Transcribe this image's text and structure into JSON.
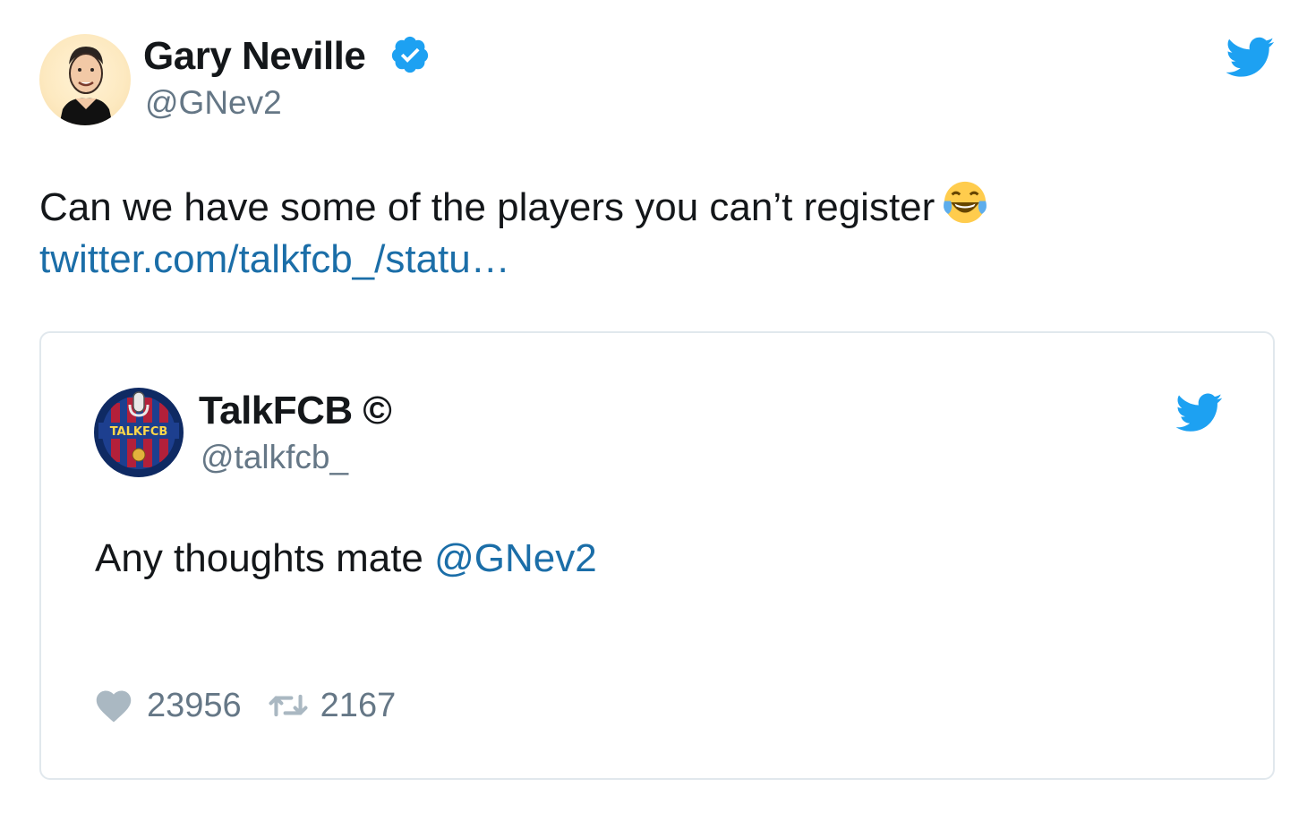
{
  "tweet": {
    "author_name": "Gary Neville",
    "author_handle": "@GNev2",
    "verified_icon": "verified-badge-icon",
    "platform_icon": "twitter-bird-icon",
    "text": "Can we have some of the players you can’t register",
    "emoji": "face-with-tears-of-joy",
    "link_text": "twitter.com/talkfcb_/statu…"
  },
  "quoted_tweet": {
    "author_name": "TalkFCB ©",
    "author_handle": "@talkfcb_",
    "avatar_text": "TALKFCB",
    "platform_icon": "twitter-bird-icon",
    "text": "Any thoughts mate",
    "mention": "@GNev2",
    "likes": "23956",
    "retweets": "2167"
  },
  "colors": {
    "twitter_blue": "#1da1f2",
    "link": "#1b6ea8",
    "secondary_text": "#657786",
    "border": "#e1e8ed"
  }
}
